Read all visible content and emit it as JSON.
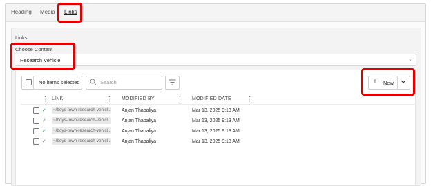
{
  "tabs": [
    {
      "label": "Heading"
    },
    {
      "label": "Media"
    },
    {
      "label": "Links"
    }
  ],
  "section_label": "Links",
  "choose_content": {
    "label": "Choose Content",
    "value": "Research Vehicle"
  },
  "toolbar": {
    "selection_text": "No items selected",
    "search_placeholder": "Search",
    "new_label": "New"
  },
  "table": {
    "columns": [
      "LINK",
      "MODIFIED BY",
      "MODIFIED DATE"
    ],
    "rows": [
      {
        "link": "~/boys-town-research-vehicl...",
        "modified_by": "Anjan Thapaliya",
        "modified_date": "Mar 13, 2025 9:13 AM"
      },
      {
        "link": "~/boys-town-research-vehicl...",
        "modified_by": "Anjan Thapaliya",
        "modified_date": "Mar 13, 2025 9:13 AM"
      },
      {
        "link": "~/boys-town-research-vehicl...",
        "modified_by": "Anjan Thapaliya",
        "modified_date": "Mar 13, 2025 9:13 AM"
      },
      {
        "link": "~/boys-town-research-vehicl...",
        "modified_by": "Anjan Thapaliya",
        "modified_date": "Mar 13, 2025 9:13 AM"
      }
    ]
  },
  "colors": {
    "highlight": "#e00000",
    "check": "#2f9b4d"
  }
}
